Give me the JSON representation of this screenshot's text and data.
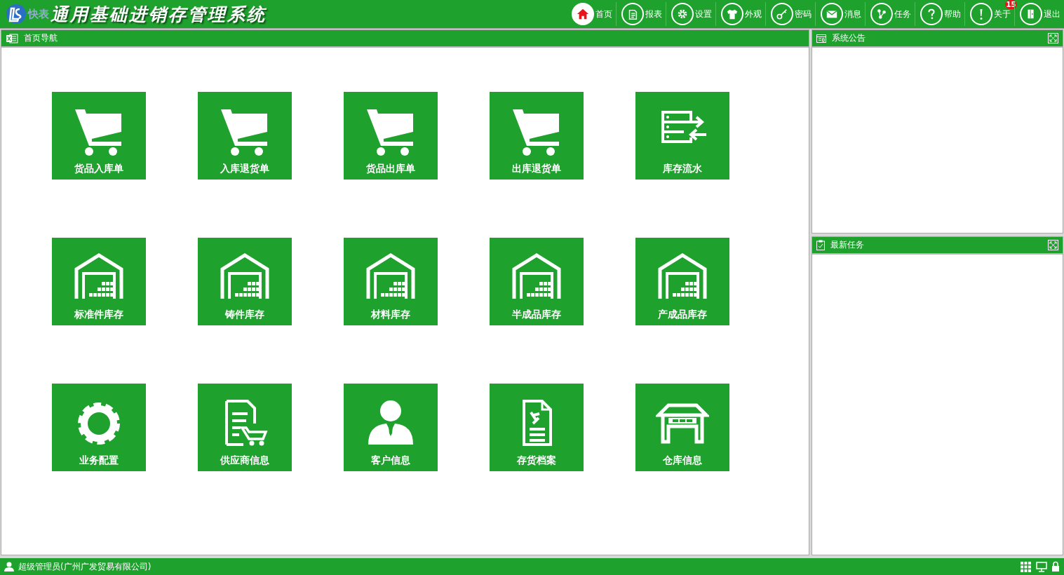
{
  "header": {
    "logo_text": "快表",
    "title": "通用基础进销存管理系统"
  },
  "toolbar": [
    {
      "kind": "home",
      "label": "首页",
      "selected": true
    },
    {
      "kind": "report",
      "label": "报表",
      "selected": false
    },
    {
      "kind": "settings",
      "label": "设置",
      "selected": false
    },
    {
      "kind": "shirt",
      "label": "外观",
      "selected": false
    },
    {
      "kind": "key",
      "label": "密码",
      "selected": false
    },
    {
      "kind": "mail",
      "label": "消息",
      "selected": false
    },
    {
      "kind": "task",
      "label": "任务",
      "selected": false
    },
    {
      "kind": "help",
      "label": "帮助",
      "selected": false
    },
    {
      "kind": "about",
      "label": "关于",
      "selected": false,
      "badge": "15"
    },
    {
      "kind": "exit",
      "label": "退出",
      "selected": false
    }
  ],
  "nav_panel": {
    "title": "首页导航",
    "tiles": [
      {
        "kind": "cart",
        "label": "货品入库单"
      },
      {
        "kind": "cart",
        "label": "入库退货单"
      },
      {
        "kind": "cart",
        "label": "货品出库单"
      },
      {
        "kind": "cart",
        "label": "出库退货单"
      },
      {
        "kind": "flow",
        "label": "库存流水"
      },
      {
        "kind": "warehouse",
        "label": "标准件库存"
      },
      {
        "kind": "warehouse",
        "label": "铸件库存"
      },
      {
        "kind": "warehouse",
        "label": "材料库存"
      },
      {
        "kind": "warehouse",
        "label": "半成品库存"
      },
      {
        "kind": "warehouse",
        "label": "产成品库存"
      },
      {
        "kind": "gear",
        "label": "业务配置"
      },
      {
        "kind": "supplier",
        "label": "供应商信息"
      },
      {
        "kind": "person",
        "label": "客户信息"
      },
      {
        "kind": "document",
        "label": "存货档案"
      },
      {
        "kind": "store",
        "label": "仓库信息"
      }
    ]
  },
  "side_panels": [
    {
      "kind": "notice",
      "title": "系统公告"
    },
    {
      "kind": "task",
      "title": "最新任务"
    }
  ],
  "status_bar": {
    "user": "超级管理员(广州广发贸易有限公司)"
  }
}
